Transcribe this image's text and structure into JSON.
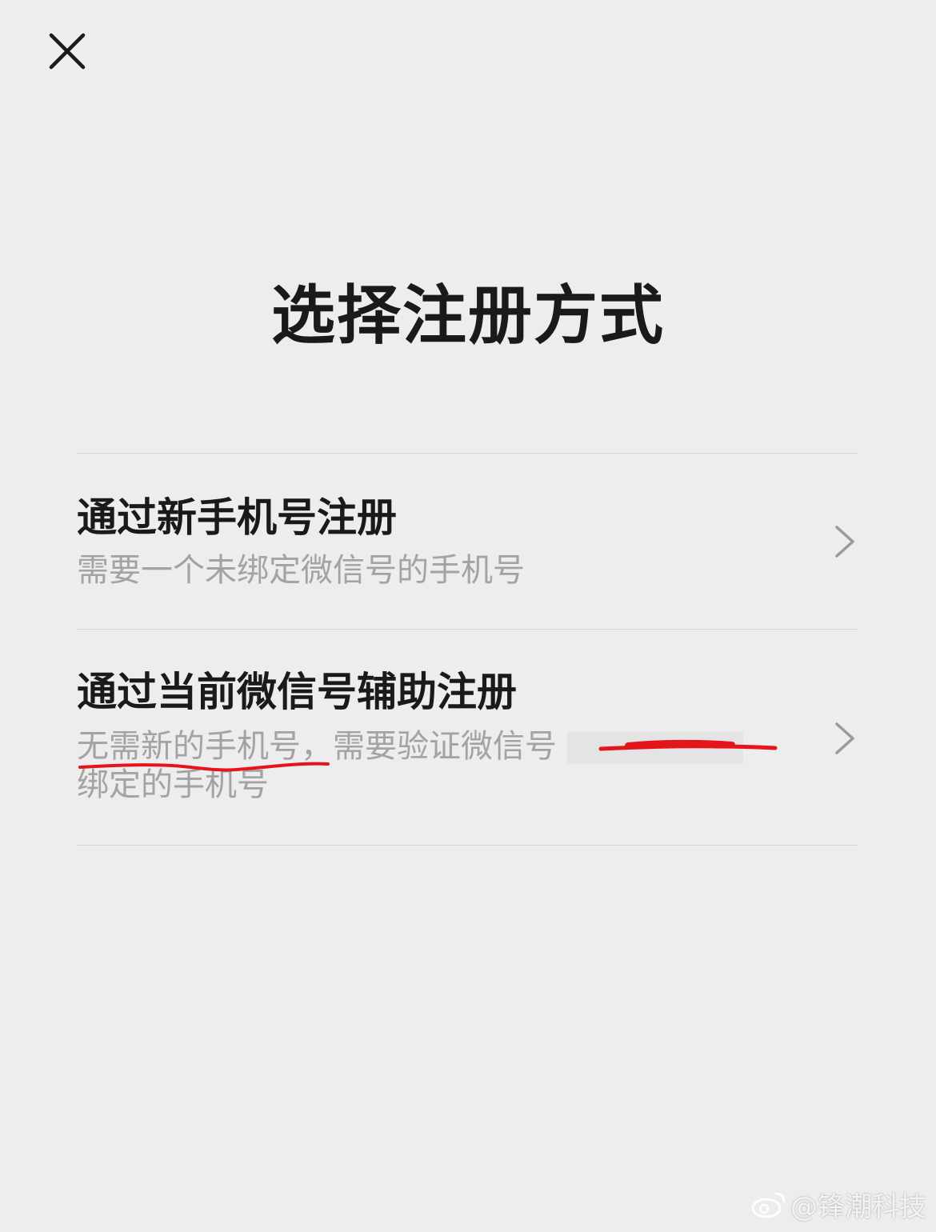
{
  "header": {
    "title": "选择注册方式"
  },
  "options": [
    {
      "title": "通过新手机号注册",
      "description": "需要一个未绑定微信号的手机号"
    },
    {
      "title": "通过当前微信号辅助注册",
      "description_line1": "无需新的手机号，需要验证微信号",
      "description_line2": "绑定的手机号"
    }
  ],
  "watermark": {
    "text": "@锋潮科技"
  },
  "icons": {
    "close": "close-icon",
    "chevron": "chevron-right-icon",
    "watermark": "weibo-icon"
  },
  "colors": {
    "background": "#ededed",
    "title": "#1a1a1a",
    "description": "#a3a3a3",
    "annotation": "#e5161b"
  }
}
